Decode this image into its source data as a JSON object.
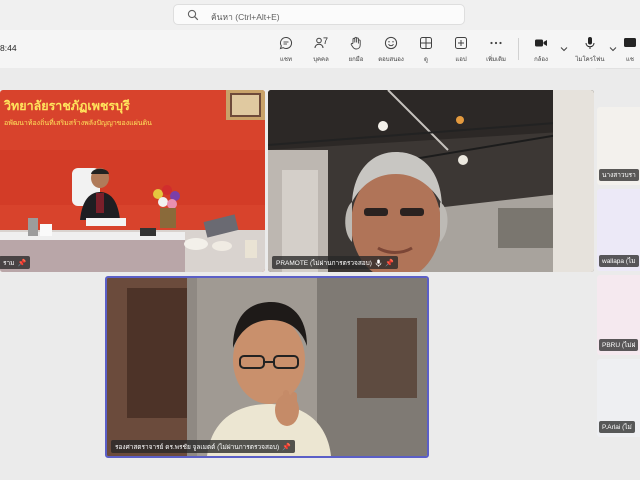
{
  "search": {
    "placeholder": "ค้นหา (Ctrl+Alt+E)"
  },
  "meeting": {
    "timer": "8:44"
  },
  "toolbar": {
    "chat_label": "แชท",
    "people_label": "บุคคล",
    "people_count": "7",
    "raise_label": "ยกมือ",
    "react_label": "ตอบสนอง",
    "view_label": "ดู",
    "apps_label": "แอป",
    "more_label": "เพิ่มเติม",
    "camera_label": "กล้อง",
    "mic_label": "ไมโครโฟน",
    "share_label": "แช"
  },
  "tiles": {
    "room": {
      "banner_line1": "วิทยาลัยราชภัฏเพชรบุรี",
      "banner_line2": "อพัฒนาท้องถิ่นที่เสริมสร้างพลังปัญญาของแผ่นดิน",
      "name": "ราม"
    },
    "pramote": {
      "name": "PRAMOTE (ไม่ผ่านการตรวจสอบ)"
    },
    "speaker": {
      "name": "รองศาสตราจารย์ ดร.พรชัย จูลเมตต์ (ไม่ผ่านการตรวจสอบ)"
    }
  },
  "sidebar": {
    "items": [
      {
        "name": "นางสาวบรา"
      },
      {
        "name": "wallapa (ไม"
      },
      {
        "name": "PBRU (ไม่ผ่"
      },
      {
        "name": "P.Arlai (ไม่"
      }
    ]
  },
  "colors": {
    "accent": "#5b5fc7",
    "banner_red": "#d8432c",
    "name_tag_bg": "#2e2e2e"
  }
}
